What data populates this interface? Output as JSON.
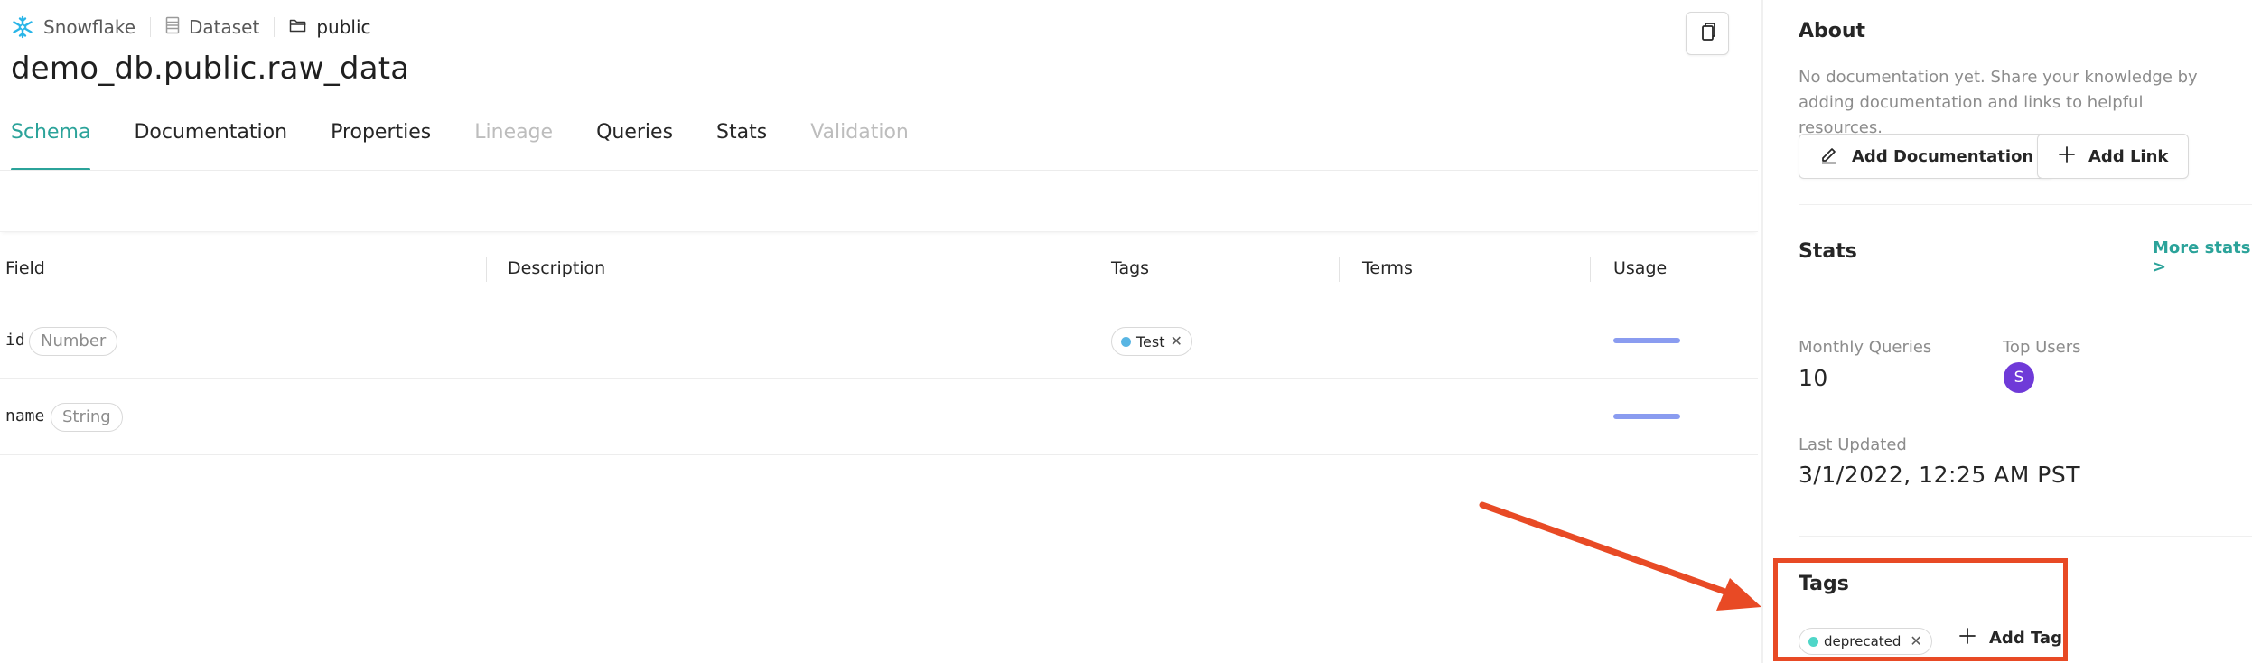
{
  "breadcrumb": {
    "platform": "Snowflake",
    "entity_type": "Dataset",
    "container": "public"
  },
  "page": {
    "title": "demo_db.public.raw_data"
  },
  "tabs": [
    {
      "label": "Schema",
      "state": "active"
    },
    {
      "label": "Documentation",
      "state": "normal"
    },
    {
      "label": "Properties",
      "state": "normal"
    },
    {
      "label": "Lineage",
      "state": "disabled"
    },
    {
      "label": "Queries",
      "state": "normal"
    },
    {
      "label": "Stats",
      "state": "normal"
    },
    {
      "label": "Validation",
      "state": "disabled"
    }
  ],
  "table": {
    "columns": [
      "Field",
      "Description",
      "Tags",
      "Terms",
      "Usage"
    ],
    "rows": [
      {
        "field": "id",
        "type": "Number",
        "tag": "Test",
        "tag_color": "#58b5e3",
        "usage_color": "#8a9cf0"
      },
      {
        "field": "name",
        "type": "String",
        "tag": "",
        "usage_color": "#8a9cf0"
      }
    ]
  },
  "sidebar": {
    "about": {
      "title": "About",
      "text": "No documentation yet. Share your knowledge by adding documentation and links to helpful resources.",
      "add_doc_label": "Add Documentation",
      "add_link_label": "Add Link"
    },
    "stats": {
      "title": "Stats",
      "more_label": "More stats >",
      "monthly_queries_label": "Monthly Queries",
      "monthly_queries_value": "10",
      "top_users_label": "Top Users",
      "top_user_initial": "S",
      "last_updated_label": "Last Updated",
      "last_updated_value": "3/1/2022, 12:25 AM PST"
    },
    "tags": {
      "title": "Tags",
      "items": [
        {
          "label": "deprecated",
          "color": "#4fd6c8"
        }
      ],
      "add_label": "Add Tag"
    }
  },
  "colors": {
    "accent": "#2ba39a",
    "annotation": "#e84a25",
    "avatar": "#6f3ad8",
    "snowflake": "#29b5e8"
  },
  "icons": [
    "snowflake-icon",
    "dataset-icon",
    "folder-icon",
    "copy-icon",
    "edit-icon",
    "plus-icon",
    "close-icon",
    "chevron-right-icon"
  ]
}
